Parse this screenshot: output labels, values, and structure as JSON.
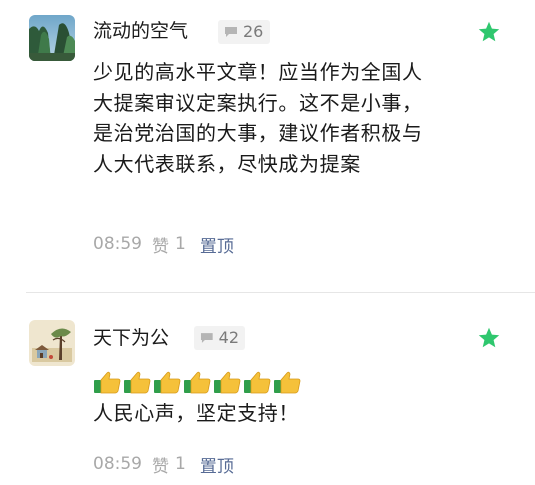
{
  "accent_color": "#2fc76e",
  "link_color": "#576b95",
  "comments": [
    {
      "nickname": "流动的空气",
      "reply_count": "26",
      "content": "少见的高水平文章！应当作为全国人大提案审议定案执行。这不是小事，是治党治国的大事，建议作者积极与人大代表联系，尽快成为提案",
      "time": "08:59",
      "like_label": "赞",
      "like_count": "1",
      "pin_label": "置顶",
      "starred": true,
      "icons": [
        "avatar-landscape",
        "comment-bubble-icon",
        "star-icon"
      ]
    },
    {
      "nickname": "天下为公",
      "reply_count": "42",
      "emoji": "👍👍👍👍👍👍👍",
      "content": "人民心声，坚定支持！",
      "time": "08:59",
      "like_label": "赞",
      "like_count": "1",
      "pin_label": "置顶",
      "starred": true,
      "icons": [
        "avatar-painting",
        "comment-bubble-icon",
        "thumbs-up-icon",
        "star-icon"
      ]
    }
  ]
}
